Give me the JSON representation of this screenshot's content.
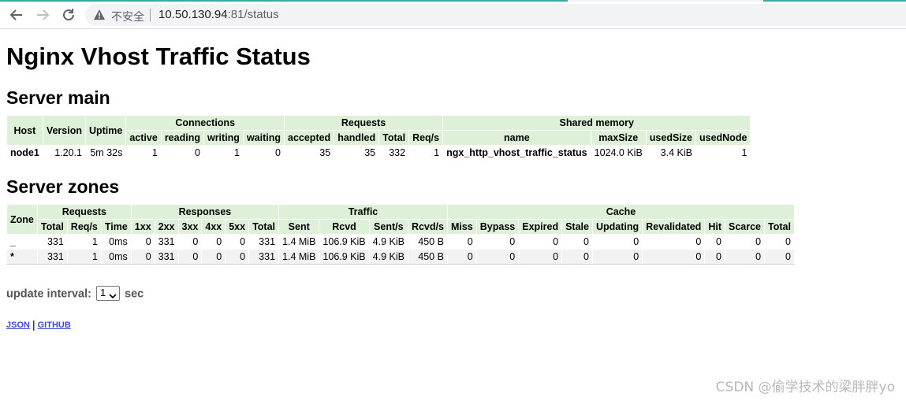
{
  "browser": {
    "security_label": "不安全",
    "url_host": "10.50.130.94",
    "url_path": ":81/status"
  },
  "page": {
    "title": "Nginx Vhost Traffic Status",
    "server_main_heading": "Server main",
    "server_zones_heading": "Server zones"
  },
  "server_main": {
    "headers": {
      "host": "Host",
      "version": "Version",
      "uptime": "Uptime",
      "connections": "Connections",
      "requests": "Requests",
      "shared_memory": "Shared memory",
      "active": "active",
      "reading": "reading",
      "writing": "writing",
      "waiting": "waiting",
      "accepted": "accepted",
      "handled": "handled",
      "total": "Total",
      "req_s": "Req/s",
      "name": "name",
      "max_size": "maxSize",
      "used_size": "usedSize",
      "used_node": "usedNode"
    },
    "row": {
      "host": "node1",
      "version": "1.20.1",
      "uptime": "5m 32s",
      "active": "1",
      "reading": "0",
      "writing": "1",
      "waiting": "0",
      "accepted": "35",
      "handled": "35",
      "total": "332",
      "req_s": "1",
      "name": "ngx_http_vhost_traffic_status",
      "max_size": "1024.0 KiB",
      "used_size": "3.4 KiB",
      "used_node": "1"
    }
  },
  "server_zones": {
    "headers": {
      "zone": "Zone",
      "requests": "Requests",
      "responses": "Responses",
      "traffic": "Traffic",
      "cache": "Cache",
      "total": "Total",
      "req_s": "Req/s",
      "time": "Time",
      "r1xx": "1xx",
      "r2xx": "2xx",
      "r3xx": "3xx",
      "r4xx": "4xx",
      "r5xx": "5xx",
      "resp_total": "Total",
      "sent": "Sent",
      "rcvd": "Rcvd",
      "sent_s": "Sent/s",
      "rcvd_s": "Rcvd/s",
      "miss": "Miss",
      "bypass": "Bypass",
      "expired": "Expired",
      "stale": "Stale",
      "updating": "Updating",
      "revalidated": "Revalidated",
      "hit": "Hit",
      "scarce": "Scarce",
      "cache_total": "Total"
    },
    "rows": [
      {
        "zone": "_",
        "total": "331",
        "req_s": "1",
        "time": "0ms",
        "r1xx": "0",
        "r2xx": "331",
        "r3xx": "0",
        "r4xx": "0",
        "r5xx": "0",
        "resp_total": "331",
        "sent": "1.4 MiB",
        "rcvd": "106.9 KiB",
        "sent_s": "4.9 KiB",
        "rcvd_s": "450 B",
        "miss": "0",
        "bypass": "0",
        "expired": "0",
        "stale": "0",
        "updating": "0",
        "revalidated": "0",
        "hit": "0",
        "scarce": "0",
        "cache_total": "0"
      },
      {
        "zone": "*",
        "total": "331",
        "req_s": "1",
        "time": "0ms",
        "r1xx": "0",
        "r2xx": "331",
        "r3xx": "0",
        "r4xx": "0",
        "r5xx": "0",
        "resp_total": "331",
        "sent": "1.4 MiB",
        "rcvd": "106.9 KiB",
        "sent_s": "4.9 KiB",
        "rcvd_s": "450 B",
        "miss": "0",
        "bypass": "0",
        "expired": "0",
        "stale": "0",
        "updating": "0",
        "revalidated": "0",
        "hit": "0",
        "scarce": "0",
        "cache_total": "0"
      }
    ]
  },
  "controls": {
    "update_interval_label": "update interval:",
    "update_interval_value": "1",
    "update_interval_unit": "sec",
    "json_link": "JSON",
    "separator": "|",
    "github_link": "GITHUB"
  },
  "watermark": "CSDN @偷学技术的梁胖胖yo",
  "colors": {
    "header_bg": "#dff0d8",
    "stripe_bg": "#f2f2f2",
    "link": "#3b4bd8"
  }
}
